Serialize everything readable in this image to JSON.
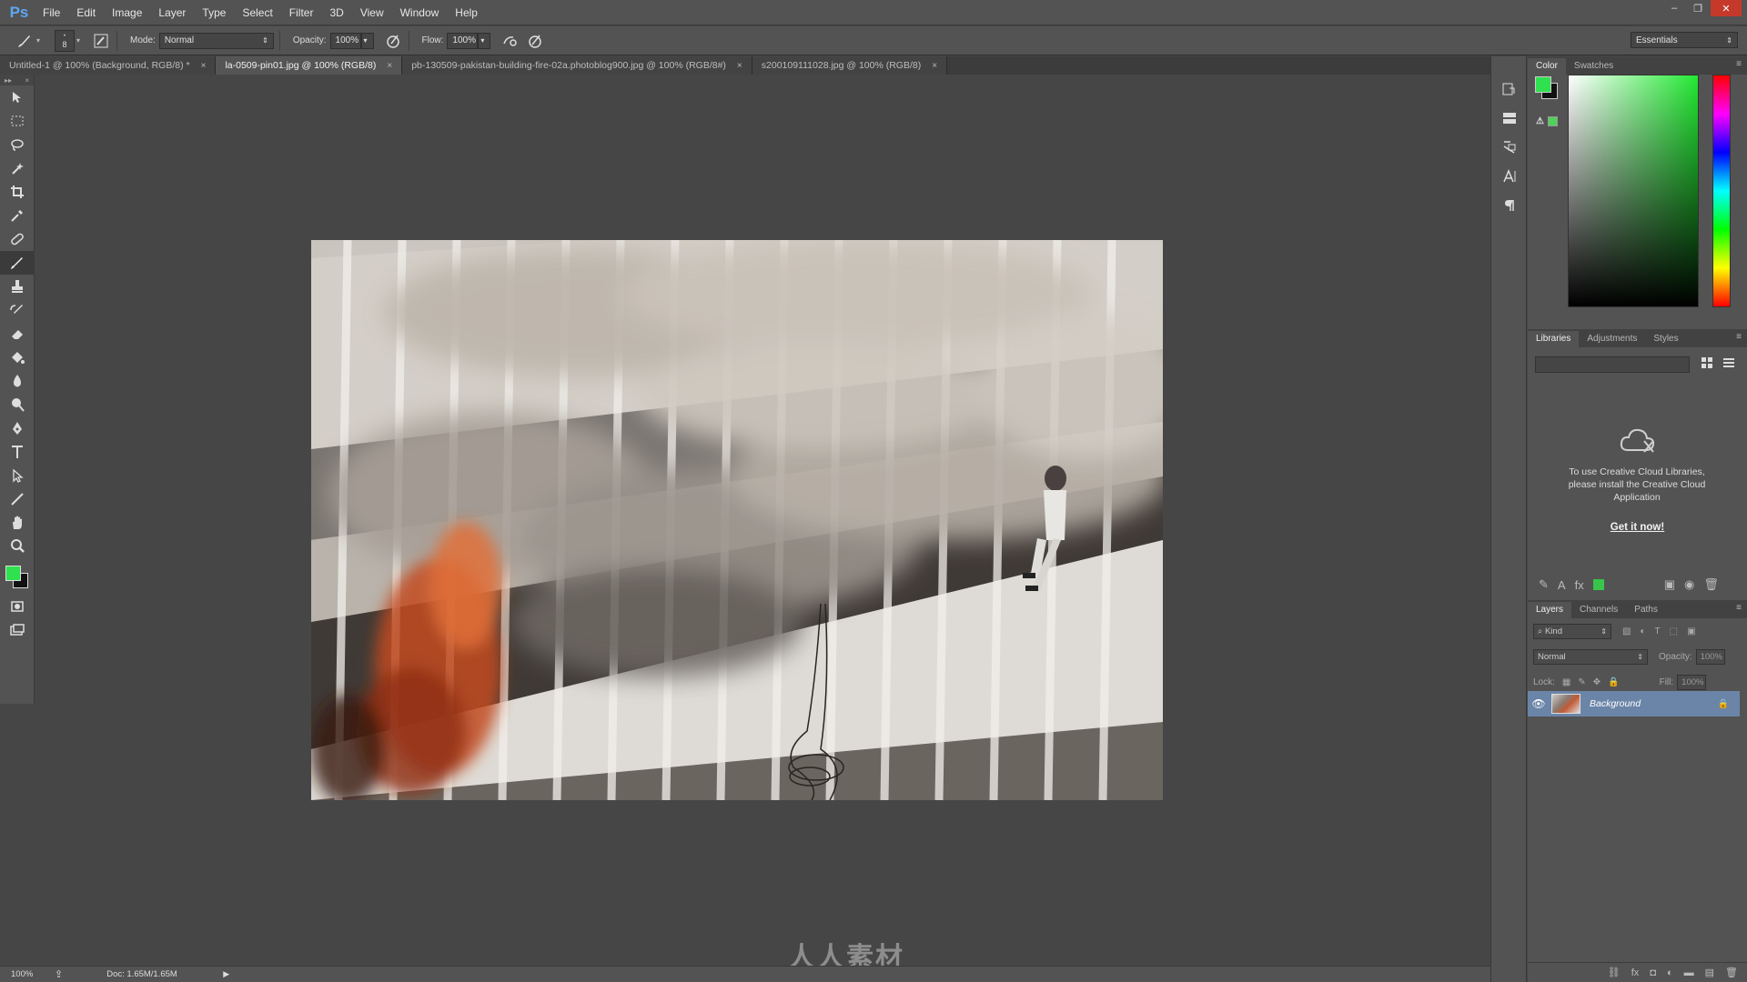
{
  "app": {
    "logo": "Ps"
  },
  "menu": [
    "File",
    "Edit",
    "Image",
    "Layer",
    "Type",
    "Select",
    "Filter",
    "3D",
    "View",
    "Window",
    "Help"
  ],
  "window_controls": {
    "minimize": "–",
    "restore": "❐",
    "close": "✕"
  },
  "options": {
    "brush_size": "8",
    "mode_label": "Mode:",
    "mode_value": "Normal",
    "opacity_label": "Opacity:",
    "opacity_value": "100%",
    "flow_label": "Flow:",
    "flow_value": "100%",
    "workspace": "Essentials"
  },
  "tabs": [
    {
      "label": "Untitled-1 @ 100% (Background, RGB/8) *",
      "active": false
    },
    {
      "label": "la-0509-pin01.jpg @ 100% (RGB/8)",
      "active": true
    },
    {
      "label": "pb-130509-pakistan-building-fire-02a.photoblog900.jpg @ 100% (RGB/8#)",
      "active": false
    },
    {
      "label": "s200109111028.jpg @ 100% (RGB/8)",
      "active": false
    }
  ],
  "tab_close": "×",
  "status": {
    "zoom": "100%",
    "doc": "Doc: 1.65M/1.65M"
  },
  "watermark": "人人素材",
  "color_panel": {
    "tabs": [
      "Color",
      "Swatches"
    ],
    "foreground": "#2fe04f",
    "background": "#111111"
  },
  "libraries_panel": {
    "tabs": [
      "Libraries",
      "Adjustments",
      "Styles"
    ],
    "message": "To use Creative Cloud Libraries, please install the Creative Cloud Application",
    "link": "Get it now!"
  },
  "layers_panel": {
    "tabs": [
      "Layers",
      "Channels",
      "Paths"
    ],
    "filter_kind": "Kind",
    "blend_mode": "Normal",
    "opacity_label": "Opacity:",
    "opacity_value": "100%",
    "lock_label": "Lock:",
    "fill_label": "Fill:",
    "fill_value": "100%",
    "layers": [
      {
        "name": "Background",
        "visible": true,
        "locked": true
      }
    ]
  }
}
